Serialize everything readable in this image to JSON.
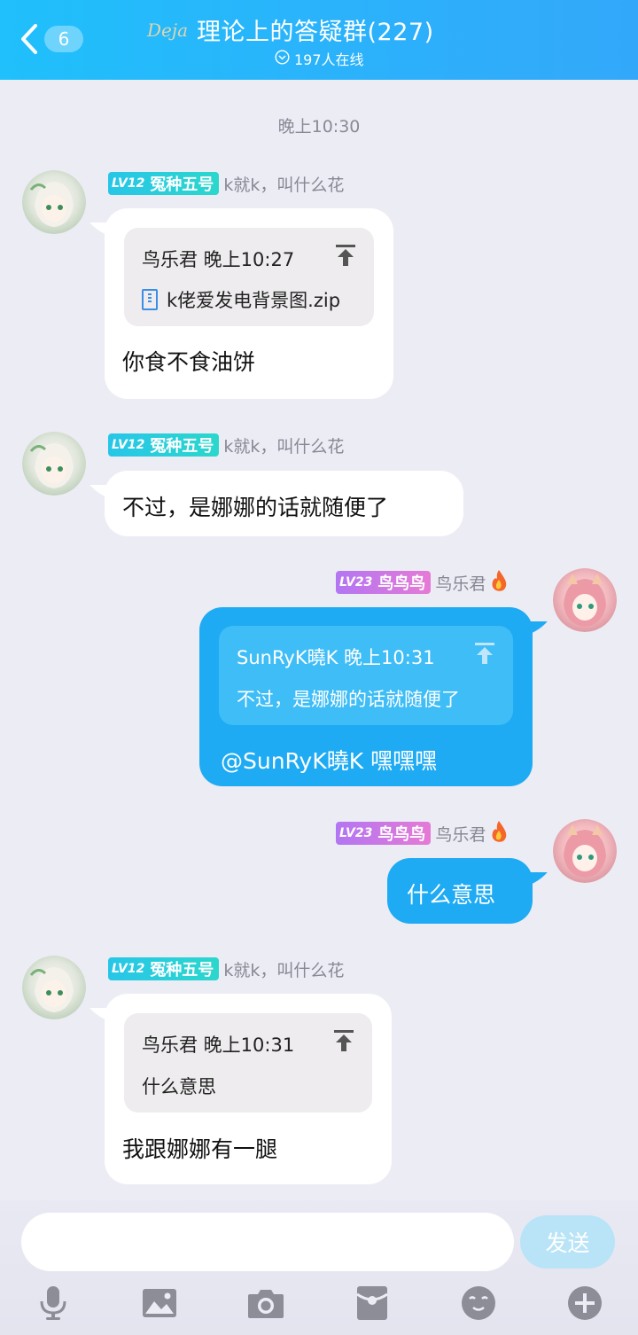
{
  "header": {
    "back_count": "6",
    "logo_text": "Deja",
    "title": "理论上的答疑群(227)",
    "online": "197人在线"
  },
  "timestamp": "晚上10:30",
  "messages": [
    {
      "badge_level": "LV12",
      "badge_title": "冤种五号",
      "name": "k就k，叫什么花",
      "quote_head": "鸟乐君  晚上10:27",
      "quote_file": "k佬爱发电背景图.zip",
      "text": "你食不食油饼"
    },
    {
      "badge_level": "LV12",
      "badge_title": "冤种五号",
      "name": "k就k，叫什么花",
      "text": "不过，是娜娜的话就随便了"
    },
    {
      "badge_level": "LV23",
      "badge_title": "鸟鸟鸟",
      "name": "鸟乐君",
      "quote_head": "SunRyK曉K  晚上10:31",
      "quote_body": "不过，是娜娜的话就随便了",
      "text": "@SunRyK曉K 嘿嘿嘿"
    },
    {
      "badge_level": "LV23",
      "badge_title": "鸟鸟鸟",
      "name": "鸟乐君",
      "text": "什么意思"
    },
    {
      "badge_level": "LV12",
      "badge_title": "冤种五号",
      "name": "k就k，叫什么花",
      "quote_head": "鸟乐君  晚上10:31",
      "quote_body": "什么意思",
      "text": "我跟娜娜有一腿"
    }
  ],
  "input": {
    "value": "",
    "send_label": "发送"
  },
  "toolbar": [
    "microphone-icon",
    "image-icon",
    "camera-icon",
    "red-packet-icon",
    "emoji-icon",
    "plus-icon"
  ],
  "colors": {
    "header": "#2ab3fb",
    "bubble_blue": "#1eabf3",
    "badge_cyan": "#27c6e8",
    "badge_purple": "#b276f2"
  }
}
